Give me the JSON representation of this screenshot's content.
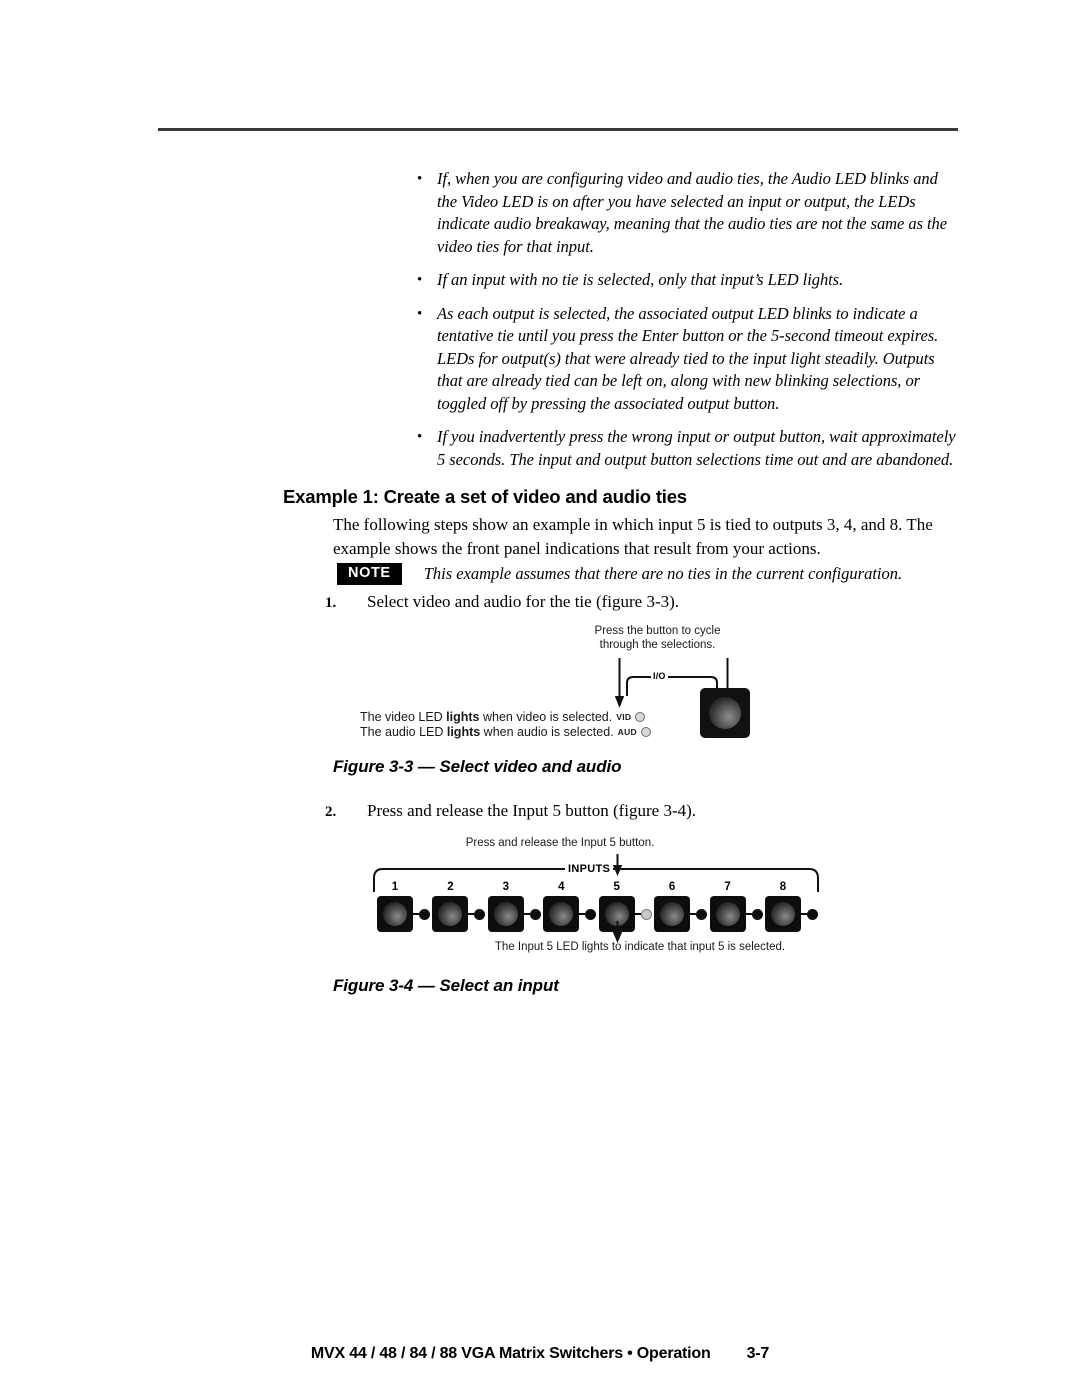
{
  "document": {
    "bullets": [
      "If, when you are configuring video and audio ties, the Audio LED blinks and the Video LED is on after you have selected an input or output, the LEDs indicate audio breakaway, meaning that the audio ties are not the same as the video ties for that input.",
      "If an input with no tie is selected, only that input’s LED lights.",
      "As each output is selected, the associated output LED blinks to indicate a tentative tie until you press the Enter button or the 5-second timeout expires.  LEDs for output(s) that were already tied to the input light steadily.  Outputs that are already tied can be left on, along with new blinking selections, or toggled off by pressing the associated output button.",
      "If you inadvertently press the wrong input or output button, wait approximately 5 seconds.  The input and output button selections time out and are abandoned."
    ],
    "bullet_glyph": "•",
    "heading": "Example 1: Create a set of video and audio ties",
    "body_paragraph": "The following steps show an example in which input 5 is tied to outputs 3, 4, and 8. The example shows the front panel indications that result from your actions.",
    "note": {
      "badge": "NOTE",
      "text": "This example assumes that there are no ties in the current configuration."
    },
    "steps": [
      {
        "number": "1.",
        "text": "Select video and audio for the tie (figure 3-3)."
      },
      {
        "number": "2.",
        "text": "Press and release the Input 5 button (figure 3-4)."
      }
    ],
    "figure_3_3": {
      "caption": "Figure 3-3 — Select video and audio",
      "callout_top_line1": "Press the button to cycle",
      "callout_top_line2": "through the selections.",
      "video_line_prefix": "The video LED ",
      "video_line_bold": "lights",
      "video_line_suffix": " when video is selected.",
      "video_led_label": "VID",
      "audio_line_prefix": "The audio LED ",
      "audio_line_bold": "lights",
      "audio_line_suffix": " when audio is selected.",
      "audio_led_label": "AUD",
      "io_label": "I/O"
    },
    "figure_3_4": {
      "caption": "Figure 3-4 — Select an input",
      "callout_top": "Press and release the Input 5 button.",
      "callout_bottom": "The Input 5 LED lights to indicate that input 5 is selected.",
      "panel_label": "INPUTS",
      "inputs": [
        {
          "number": "1",
          "lit": false
        },
        {
          "number": "2",
          "lit": false
        },
        {
          "number": "3",
          "lit": false
        },
        {
          "number": "4",
          "lit": false
        },
        {
          "number": "5",
          "lit": true
        },
        {
          "number": "6",
          "lit": false
        },
        {
          "number": "7",
          "lit": false
        },
        {
          "number": "8",
          "lit": false
        }
      ]
    },
    "footer": {
      "title": "MVX 44 / 48 / 84 / 88 VGA Matrix Switchers • Operation",
      "page_number": "3-7"
    }
  },
  "colors": {
    "text": "#000000",
    "rule": "#3a3a3a",
    "note_badge_bg": "#000000",
    "note_badge_fg": "#ffffff",
    "button_body": "#0d0d0d",
    "led_lit": "#c9c9c9",
    "led_unlit": "#0d0d0d"
  }
}
